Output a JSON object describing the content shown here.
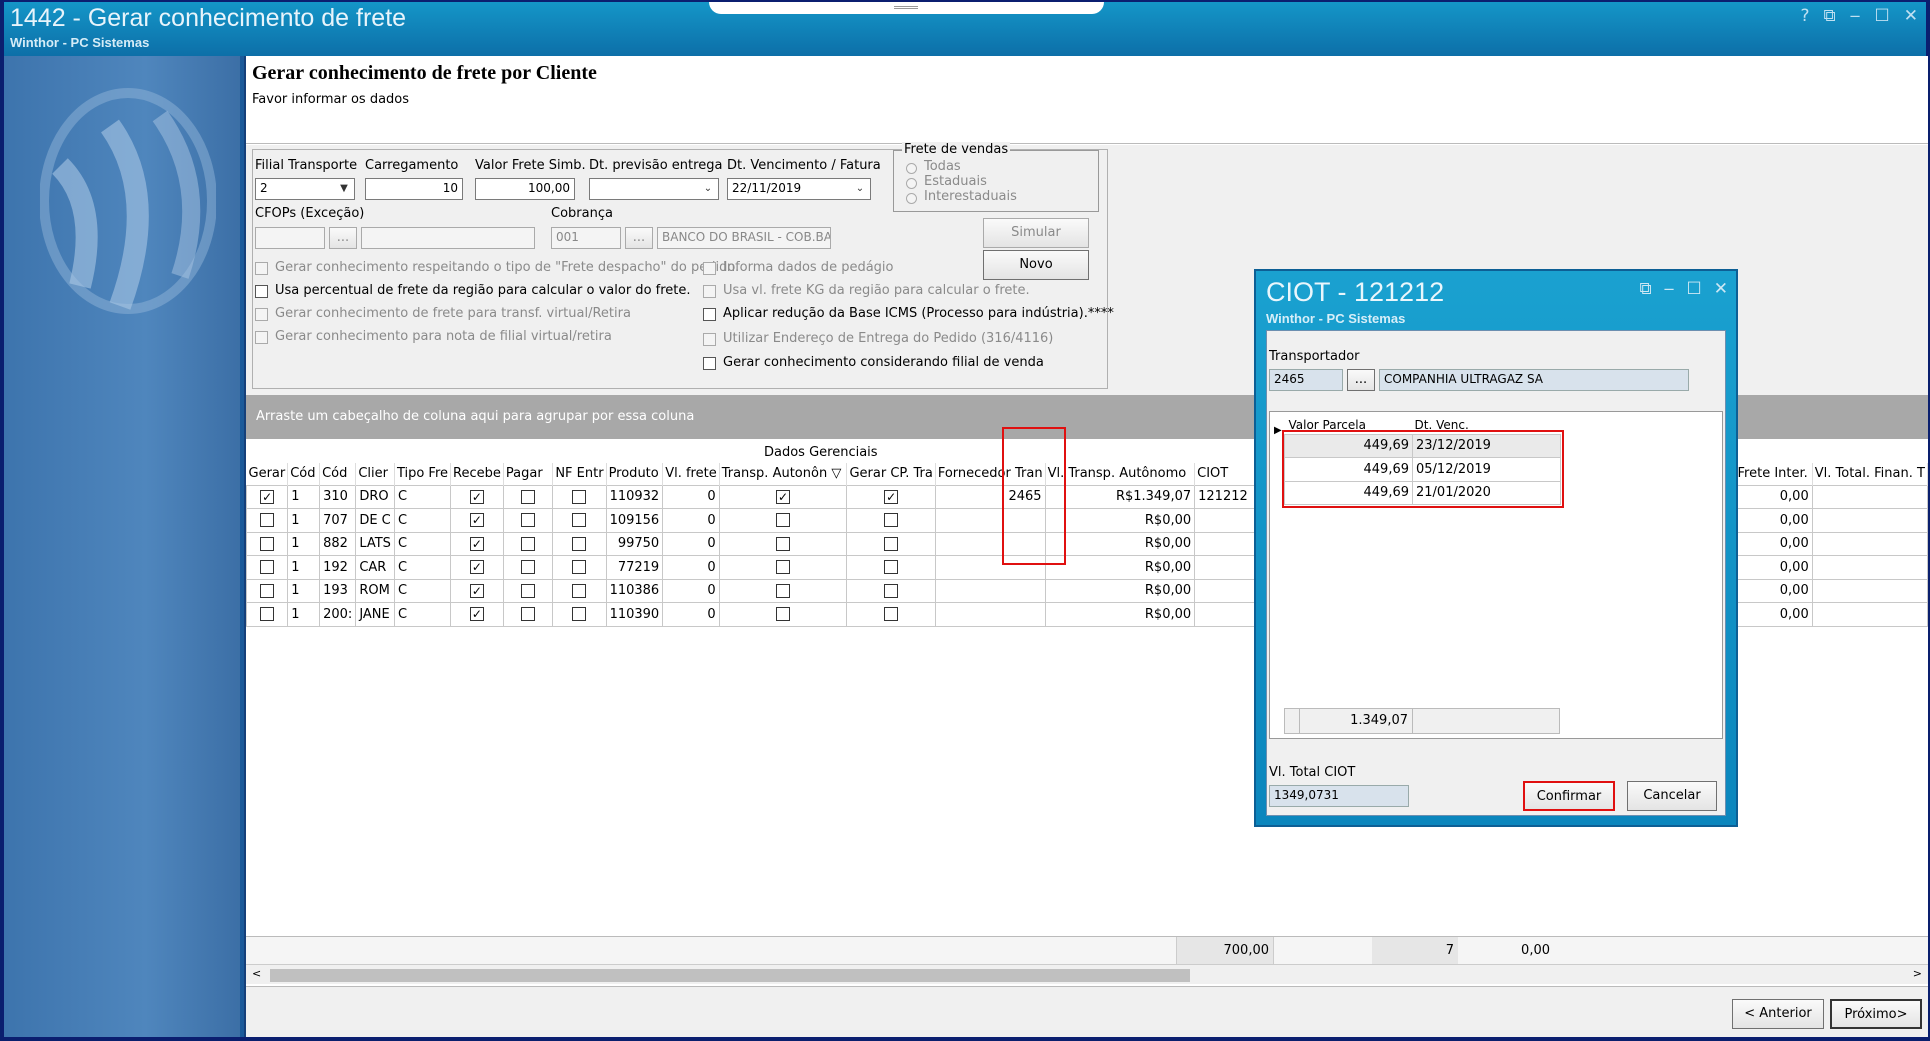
{
  "window": {
    "title": "1442 - Gerar conhecimento de frete",
    "subtitle": "Winthor - PC Sistemas",
    "controls": [
      "?",
      "⧉",
      "‒",
      "☐",
      "✕"
    ]
  },
  "header": {
    "title": "Gerar conhecimento de frete por Cliente",
    "subtitle": "Favor informar os dados"
  },
  "form": {
    "filial_label": "Filial Transporte",
    "filial_value": "2",
    "carregamento_label": "Carregamento",
    "carregamento_value": "10",
    "valor_frete_label": "Valor Frete Simb.",
    "valor_frete_value": "100,00",
    "dt_previsao_label": "Dt. previsão entrega",
    "dt_previsao_value": "",
    "dt_venc_label": "Dt. Vencimento / Fatura",
    "dt_venc_value": "22/11/2019",
    "frete_vendas_label": "Frete de vendas",
    "frete_options": [
      "Todas",
      "Estaduais",
      "Interestaduais"
    ],
    "cfops_label": "CFOPs (Exceção)",
    "cobranca_label": "Cobrança",
    "cobranca_code": "001",
    "cobranca_name": "BANCO DO BRASIL - COB.BA",
    "ellipsis": "...",
    "simular": "Simular",
    "novo": "Novo",
    "checks_left": [
      "Gerar conhecimento respeitando o tipo de \"Frete despacho\" do pedido.",
      "Usa percentual de frete da região para calcular o valor do frete.",
      "Gerar conhecimento de frete para transf. virtual/Retira",
      "Gerar conhecimento para nota de filial virtual/retira"
    ],
    "checks_right": [
      "Informa dados de pedágio",
      "Usa vl. frete KG da região para calcular o frete.",
      "Aplicar redução da Base ICMS (Processo para indústria).****",
      "Utilizar Endereço de Entrega do Pedido (316/4116)",
      "Gerar conhecimento considerando filial de venda"
    ]
  },
  "grid": {
    "group_hint": "Arraste um cabeçalho de coluna aqui para agrupar por essa coluna",
    "band": "Dados Gerenciais",
    "columns": [
      "Gerar",
      "Cód",
      "Cód",
      "Clier",
      "Tipo Fre",
      "Recebe",
      "Pagar",
      "NF Entr",
      "Produto",
      "Vl. frete",
      "Transp. Autonôn",
      "Gerar CP. Tra",
      "Fornecedor Tran",
      "Vl. Transp. Autônomo",
      "CIOT",
      "Vl.Frete Inter.",
      "Vl. Total. Finan. T"
    ],
    "filter_icon": "▽",
    "rows": [
      {
        "gerar": true,
        "c1": "1",
        "c2": "310",
        "cli": "DRO",
        "tipo": "C",
        "rec": true,
        "pag": false,
        "nf": false,
        "prod": "110932",
        "vlf": "0",
        "ta": true,
        "gcp": true,
        "forn": "2465",
        "vta": "R$1.349,07",
        "ciot": "121212",
        "vfi": "0,00"
      },
      {
        "gerar": false,
        "c1": "1",
        "c2": "707",
        "cli": "DE C",
        "tipo": "C",
        "rec": true,
        "pag": false,
        "nf": false,
        "prod": "109156",
        "vlf": "0",
        "ta": false,
        "gcp": false,
        "forn": "",
        "vta": "R$0,00",
        "ciot": "",
        "vfi": "0,00"
      },
      {
        "gerar": false,
        "c1": "1",
        "c2": "882",
        "cli": "LATS",
        "tipo": "C",
        "rec": true,
        "pag": false,
        "nf": false,
        "prod": "99750",
        "vlf": "0",
        "ta": false,
        "gcp": false,
        "forn": "",
        "vta": "R$0,00",
        "ciot": "",
        "vfi": "0,00"
      },
      {
        "gerar": false,
        "c1": "1",
        "c2": "192",
        "cli": "CAR",
        "tipo": "C",
        "rec": true,
        "pag": false,
        "nf": false,
        "prod": "77219",
        "vlf": "0",
        "ta": false,
        "gcp": false,
        "forn": "",
        "vta": "R$0,00",
        "ciot": "",
        "vfi": "0,00"
      },
      {
        "gerar": false,
        "c1": "1",
        "c2": "193",
        "cli": "ROM",
        "tipo": "C",
        "rec": true,
        "pag": false,
        "nf": false,
        "prod": "110386",
        "vlf": "0",
        "ta": false,
        "gcp": false,
        "forn": "",
        "vta": "R$0,00",
        "ciot": "",
        "vfi": "0,00"
      },
      {
        "gerar": false,
        "c1": "1",
        "c2": "200:",
        "cli": "JANE",
        "tipo": "C",
        "rec": true,
        "pag": false,
        "nf": false,
        "prod": "110390",
        "vlf": "0",
        "ta": false,
        "gcp": false,
        "forn": "",
        "vta": "R$0,00",
        "ciot": "",
        "vfi": "0,00"
      }
    ],
    "footer": {
      "total1": "700,00",
      "count": "7",
      "total2": "0,00"
    }
  },
  "nav": {
    "prev": "< Anterior",
    "next": "Próximo>"
  },
  "dialog": {
    "title": "CIOT - 121212",
    "subtitle": "Winthor - PC Sistemas",
    "controls": [
      "⧉",
      "‒",
      "☐",
      "✕"
    ],
    "transportador_label": "Transportador",
    "transp_code": "2465",
    "transp_name": "COMPANHIA ULTRAGAZ SA",
    "columns": [
      "Valor Parcela",
      "Dt. Venc."
    ],
    "parcelas": [
      {
        "valor": "449,69",
        "data": "23/12/2019"
      },
      {
        "valor": "449,69",
        "data": "05/12/2019"
      },
      {
        "valor": "449,69",
        "data": "21/01/2020"
      }
    ],
    "sum": "1.349,07",
    "total_label": "Vl. Total CIOT",
    "total_value": "1349,0731",
    "confirmar": "Confirmar",
    "cancelar": "Cancelar"
  }
}
